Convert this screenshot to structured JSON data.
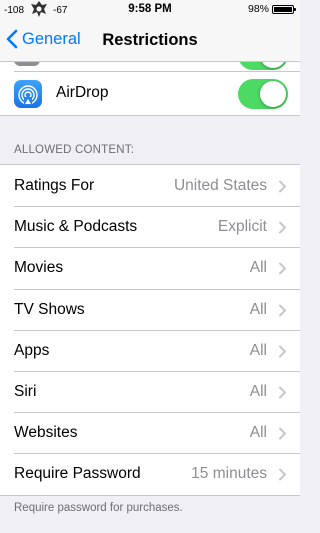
{
  "status_bar": {
    "signal_left": "-108",
    "signal_right": "-67",
    "time": "9:58 PM",
    "battery": "98%",
    "battery_level": 0.98
  },
  "nav": {
    "back_label": "General",
    "title": "Restrictions"
  },
  "airdrop": {
    "label": "AirDrop",
    "enabled": true
  },
  "allowed_content": {
    "header": "ALLOWED CONTENT:",
    "rows": [
      {
        "label": "Ratings For",
        "value": "United States"
      },
      {
        "label": "Music & Podcasts",
        "value": "Explicit"
      },
      {
        "label": "Movies",
        "value": "All"
      },
      {
        "label": "TV Shows",
        "value": "All"
      },
      {
        "label": "Apps",
        "value": "All"
      },
      {
        "label": "Siri",
        "value": "All"
      },
      {
        "label": "Websites",
        "value": "All"
      },
      {
        "label": "Require Password",
        "value": "15 minutes"
      }
    ],
    "footer": "Require password for purchases."
  },
  "colors": {
    "accent": "#007aff",
    "toggle_on": "#4cd964",
    "background": "#efeff4",
    "secondary_text": "#8e8e93"
  }
}
